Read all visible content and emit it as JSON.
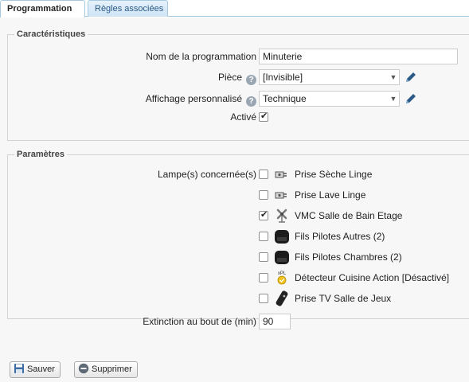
{
  "tabs": [
    {
      "label": "Programmation",
      "active": true
    },
    {
      "label": "Règles associées",
      "active": false
    }
  ],
  "characteristics": {
    "legend": "Caractéristiques",
    "name_label": "Nom de la programmation",
    "name_value": "Minuterie",
    "room_label": "Pièce",
    "room_value": "[Invisible]",
    "display_label": "Affichage personnalisé",
    "display_value": "Technique",
    "active_label": "Activé",
    "active_checked": true
  },
  "parameters": {
    "legend": "Paramètres",
    "lamps_label": "Lampe(s) concernée(s)",
    "lamps": [
      {
        "name": "Prise Sèche Linge",
        "checked": false,
        "icon": "plug-icon"
      },
      {
        "name": "Prise Lave Linge",
        "checked": false,
        "icon": "plug-icon"
      },
      {
        "name": "VMC Salle de Bain Etage",
        "checked": true,
        "icon": "fan-icon"
      },
      {
        "name": "Fils Pilotes Autres (2)",
        "checked": false,
        "icon": "module-icon"
      },
      {
        "name": "Fils Pilotes Chambres (2)",
        "checked": false,
        "icon": "module-icon"
      },
      {
        "name": "Détecteur Cuisine Action [Désactivé]",
        "checked": false,
        "icon": "xpl-sensor-icon",
        "icon_text": "xPL"
      },
      {
        "name": "Prise TV Salle de Jeux",
        "checked": false,
        "icon": "remote-icon"
      }
    ],
    "extinction_label": "Extinction au bout de (min)",
    "extinction_value": "90"
  },
  "actions": {
    "save_label": "Sauver",
    "delete_label": "Supprimer"
  },
  "colors": {
    "tab_border": "#a6c9e2",
    "accent_blue": "#2a5a86",
    "panel_bg": "#f7f7f7"
  }
}
